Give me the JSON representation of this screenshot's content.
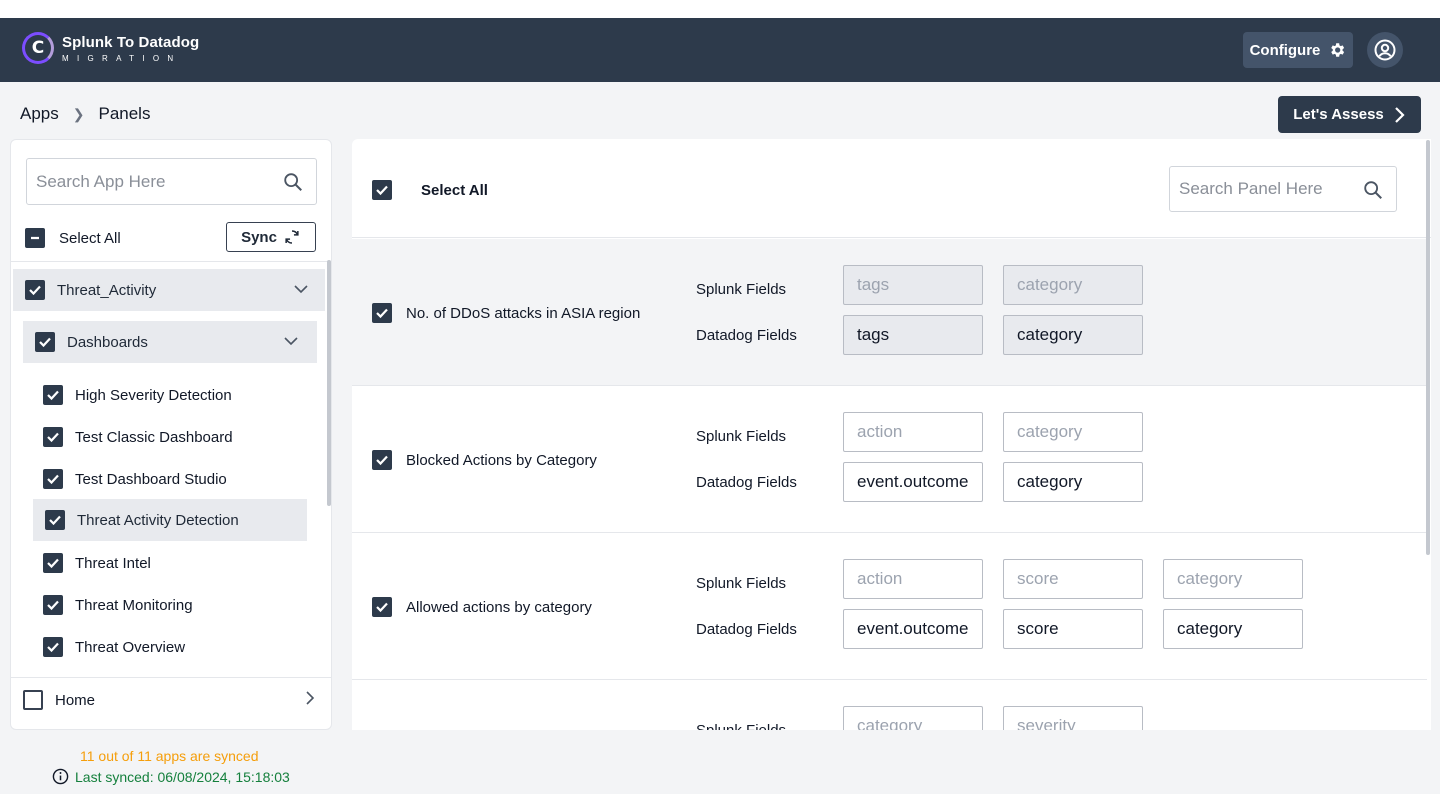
{
  "app": {
    "logo_letter": "C",
    "title": "Splunk To Datadog",
    "subtitle": "MIGRATION",
    "configure_label": "Configure",
    "brand_color": "#2d3a4b",
    "accent_color": "#7c4dff"
  },
  "breadcrumb": {
    "items": [
      "Apps",
      "Panels"
    ]
  },
  "assess_label": "Let's Assess",
  "left": {
    "search_placeholder": "Search App Here",
    "select_all_label": "Select All",
    "sync_label": "Sync",
    "app_name": "Threat_Activity",
    "group_name": "Dashboards",
    "dashboards": [
      "High Severity Detection",
      "Test Classic Dashboard",
      "Test Dashboard Studio",
      "Threat Activity Detection",
      "Threat Intel",
      "Threat Monitoring",
      "Threat Overview"
    ],
    "home_label": "Home"
  },
  "status": {
    "synced_count": "11 out of 11 apps are synced",
    "last_synced": "Last synced: 06/08/2024, 15:18:03",
    "synced_color": "#f59e0b",
    "last_synced_color": "#15803d"
  },
  "main": {
    "select_all_label": "Select All",
    "search_placeholder": "Search Panel Here",
    "splunk_label": "Splunk Fields",
    "datadog_label": "Datadog Fields",
    "panels": [
      {
        "name": "No. of DDoS attacks in ASIA region",
        "splunk": [
          "tags",
          "category"
        ],
        "datadog": [
          "tags",
          "category"
        ]
      },
      {
        "name": "Blocked Actions by Category",
        "splunk": [
          "action",
          "category"
        ],
        "datadog": [
          "event.outcome",
          "category"
        ]
      },
      {
        "name": "Allowed actions by category",
        "splunk": [
          "action",
          "score",
          "category"
        ],
        "datadog": [
          "event.outcome",
          "score",
          "category"
        ]
      },
      {
        "name": "",
        "splunk": [
          "category",
          "severity"
        ],
        "datadog": []
      }
    ]
  }
}
